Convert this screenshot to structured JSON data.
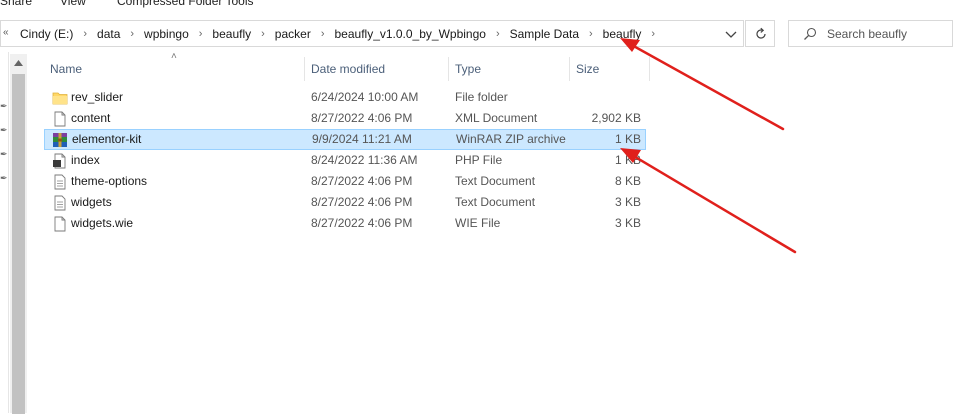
{
  "ribbon": {
    "tabs": [
      "Share",
      "View",
      "Compressed Folder Tools"
    ]
  },
  "address": {
    "lead": "«",
    "crumbs": [
      "Cindy (E:)",
      "data",
      "wpbingo",
      "beaufly",
      "packer",
      "beaufly_v1.0.0_by_Wpbingo",
      "Sample Data",
      "beaufly"
    ]
  },
  "search": {
    "placeholder": "Search beaufly"
  },
  "columns": {
    "name": "Name",
    "date": "Date modified",
    "type": "Type",
    "size": "Size"
  },
  "files": [
    {
      "name": "rev_slider",
      "date": "6/24/2024 10:00 AM",
      "type": "File folder",
      "size": "",
      "icon": "folder-icon"
    },
    {
      "name": "content",
      "date": "8/27/2022 4:06 PM",
      "type": "XML Document",
      "size": "2,902 KB",
      "icon": "document-icon"
    },
    {
      "name": "elementor-kit",
      "date": "9/9/2024 11:21 AM",
      "type": "WinRAR ZIP archive",
      "size": "1 KB",
      "icon": "winrar-archive-icon",
      "selected": true
    },
    {
      "name": "index",
      "date": "8/24/2022 11:36 AM",
      "type": "PHP File",
      "size": "1 KB",
      "icon": "php-file-icon"
    },
    {
      "name": "theme-options",
      "date": "8/27/2022 4:06 PM",
      "type": "Text Document",
      "size": "8 KB",
      "icon": "text-document-icon"
    },
    {
      "name": "widgets",
      "date": "8/27/2022 4:06 PM",
      "type": "Text Document",
      "size": "3 KB",
      "icon": "text-document-icon"
    },
    {
      "name": "widgets.wie",
      "date": "8/27/2022 4:06 PM",
      "type": "WIE File",
      "size": "3 KB",
      "icon": "document-icon"
    }
  ],
  "colors": {
    "selection": "#cce8ff",
    "selection_border": "#99d1ff",
    "annotation": "#e0201c",
    "header_text": "#4c607a"
  }
}
